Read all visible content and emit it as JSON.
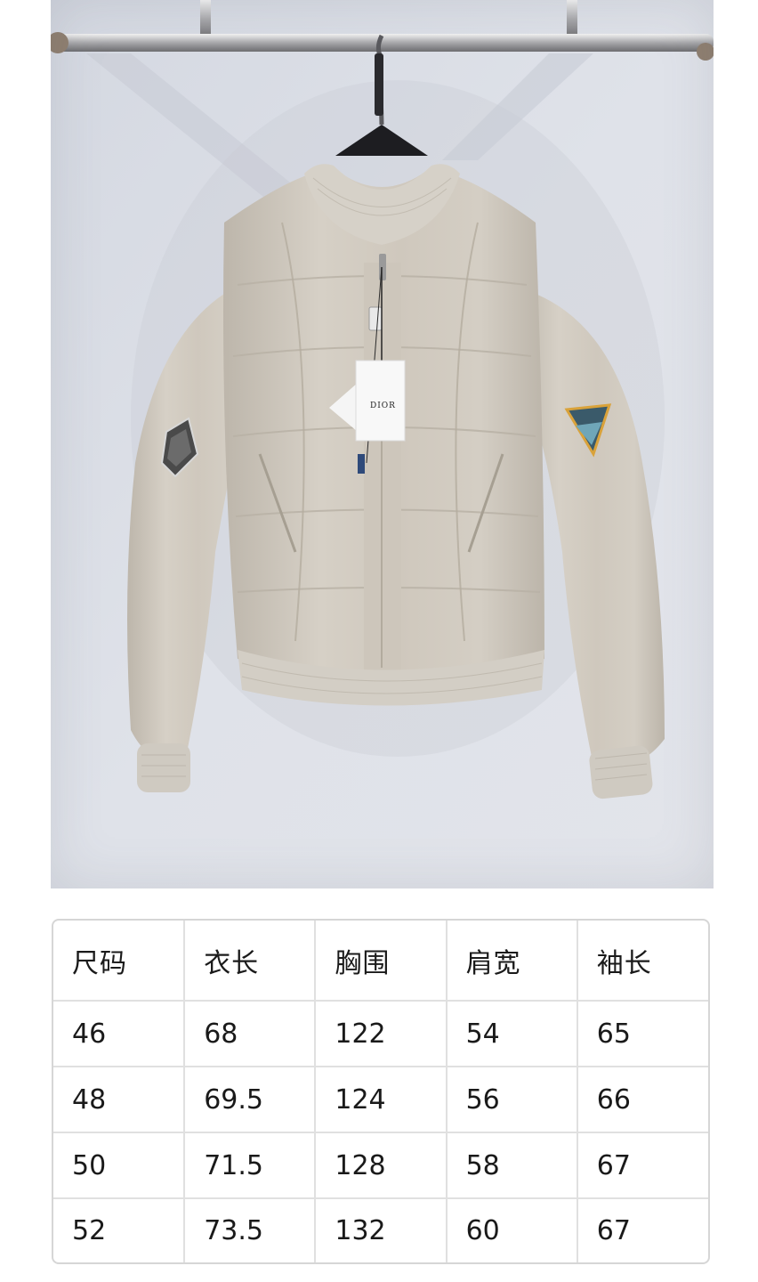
{
  "photo": {
    "hang_tag_brand": "DIOR"
  },
  "size_table": {
    "headers": [
      "尺码",
      "衣长",
      "胸围",
      "肩宽",
      "袖长"
    ],
    "rows": [
      [
        "46",
        "68",
        "122",
        "54",
        "65"
      ],
      [
        "48",
        "69.5",
        "124",
        "56",
        "66"
      ],
      [
        "50",
        "71.5",
        "128",
        "58",
        "67"
      ],
      [
        "52",
        "73.5",
        "132",
        "60",
        "67"
      ]
    ]
  }
}
